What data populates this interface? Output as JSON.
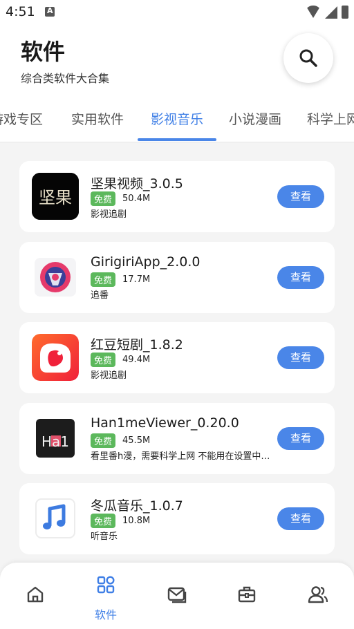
{
  "status_bar": {
    "time": "4:51"
  },
  "header": {
    "title": "软件",
    "subtitle": "综合类软件大合集",
    "search_icon": "search-icon"
  },
  "tabs": [
    {
      "label": "游戏专区",
      "active": false
    },
    {
      "label": "实用软件",
      "active": false
    },
    {
      "label": "影视音乐",
      "active": true
    },
    {
      "label": "小说漫画",
      "active": false
    },
    {
      "label": "科学上网",
      "active": false
    }
  ],
  "apps": [
    {
      "name": "坚果视频_3.0.5",
      "badge": "免费",
      "size": "50.4M",
      "desc": "影视追剧",
      "button": "查看",
      "icon_text": "坚果"
    },
    {
      "name": "GirigiriApp_2.0.0",
      "badge": "免费",
      "size": "17.7M",
      "desc": "追番",
      "button": "查看",
      "icon_text": ""
    },
    {
      "name": "红豆短剧_1.8.2",
      "badge": "免费",
      "size": "49.4M",
      "desc": "影视追剧",
      "button": "查看",
      "icon_text": ""
    },
    {
      "name": "Han1meViewer_0.20.0",
      "badge": "免费",
      "size": "45.5M",
      "desc": "看里番h漫，需要科学上网 不能用在设置中开启代理",
      "button": "查看",
      "icon_text": "Ha1"
    },
    {
      "name": "冬瓜音乐_1.0.7",
      "badge": "免费",
      "size": "10.8M",
      "desc": "听音乐",
      "button": "查看",
      "icon_text": ""
    }
  ],
  "bottom_nav": [
    {
      "icon": "home-icon",
      "label": ""
    },
    {
      "icon": "grid-icon",
      "label": "软件",
      "active": true
    },
    {
      "icon": "mail-icon",
      "label": ""
    },
    {
      "icon": "toolbox-icon",
      "label": ""
    },
    {
      "icon": "users-icon",
      "label": ""
    }
  ],
  "colors": {
    "accent": "#4a86e8",
    "badge_green": "#5cb85c"
  }
}
